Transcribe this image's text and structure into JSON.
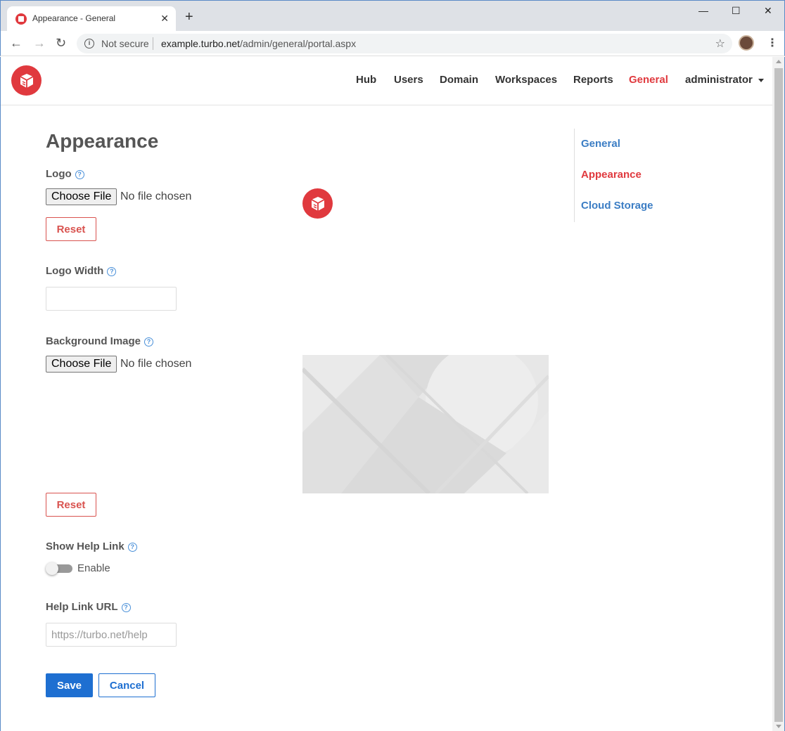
{
  "browser": {
    "tab_title": "Appearance - General",
    "tab_close": "✕",
    "new_tab": "+",
    "minimize": "—",
    "maximize": "☐",
    "close": "✕",
    "back": "←",
    "forward": "→",
    "reload": "↻",
    "security_label": "Not secure",
    "url_host": "example.turbo.net",
    "url_path": "/admin/general/portal.aspx",
    "star": "☆",
    "menu": "⋮",
    "info_glyph": "i"
  },
  "header": {
    "nav": [
      {
        "label": "Hub"
      },
      {
        "label": "Users"
      },
      {
        "label": "Domain"
      },
      {
        "label": "Workspaces"
      },
      {
        "label": "Reports"
      },
      {
        "label": "General",
        "active": true
      },
      {
        "label": "administrator"
      }
    ]
  },
  "main": {
    "title": "Appearance",
    "help_glyph": "?",
    "logo": {
      "label": "Logo",
      "file_button": "Choose File",
      "file_status": "No file chosen",
      "reset": "Reset"
    },
    "logo_width": {
      "label": "Logo Width",
      "value": ""
    },
    "background": {
      "label": "Background Image",
      "file_button": "Choose File",
      "file_status": "No file chosen",
      "reset": "Reset"
    },
    "help_link": {
      "label": "Show Help Link",
      "toggle_label": "Enable",
      "enabled": false
    },
    "help_url": {
      "label": "Help Link URL",
      "placeholder": "https://turbo.net/help",
      "value": ""
    },
    "save": "Save",
    "cancel": "Cancel"
  },
  "sidebar": {
    "items": [
      {
        "label": "General"
      },
      {
        "label": "Appearance",
        "active": true
      },
      {
        "label": "Cloud Storage"
      }
    ]
  },
  "colors": {
    "brand": "#e0393e",
    "link": "#3b7dc4",
    "primary": "#1e6fd1",
    "danger": "#d9534f"
  }
}
